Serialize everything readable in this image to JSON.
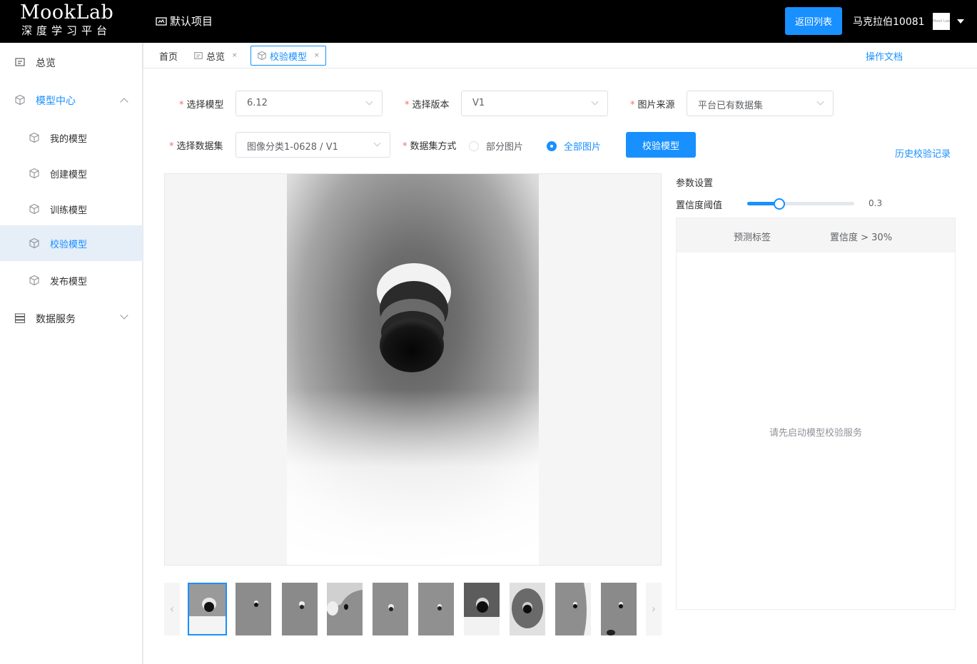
{
  "header": {
    "logo_main": "MookLab",
    "logo_sub": "深度学习平台",
    "project_name": "默认项目",
    "back_button": "返回列表",
    "username": "马克拉伯10081",
    "avatar_text": "Mook Lab"
  },
  "sidebar": {
    "items": [
      {
        "label": "总览",
        "icon": "overview-icon"
      },
      {
        "label": "模型中心",
        "icon": "cube-icon"
      },
      {
        "label": "我的模型",
        "icon": "cube-icon"
      },
      {
        "label": "创建模型",
        "icon": "cube-plus-icon"
      },
      {
        "label": "训练模型",
        "icon": "cube-icon"
      },
      {
        "label": "校验模型",
        "icon": "cube-check-icon"
      },
      {
        "label": "发布模型",
        "icon": "cube-icon"
      },
      {
        "label": "数据服务",
        "icon": "database-icon"
      }
    ]
  },
  "tabs": {
    "items": [
      {
        "label": "首页"
      },
      {
        "label": "总览",
        "close": "×"
      },
      {
        "label": "校验模型",
        "close": "×"
      }
    ],
    "docs": "操作文档"
  },
  "form": {
    "model_label": "选择模型",
    "model_value": "6.12",
    "version_label": "选择版本",
    "version_value": "V1",
    "source_label": "图片来源",
    "source_value": "平台已有数据集",
    "dataset_label": "选择数据集",
    "dataset_value": "图像分类1-0628 / V1",
    "mode_label": "数据集方式",
    "mode_option_partial": "部分图片",
    "mode_option_all": "全部图片",
    "verify_button": "校验模型",
    "history_link": "历史校验记录"
  },
  "params": {
    "title": "参数设置",
    "confidence_label": "置信度阈值",
    "confidence_value": "0.3",
    "confidence_fraction": 0.3
  },
  "results": {
    "col_label": "预测标签",
    "col_conf": "置信度 > 30%",
    "empty_text": "请先启动模型校验服务"
  },
  "thumbnails": {
    "count": 10,
    "selected_index": 0,
    "prev": "‹",
    "next": "›"
  },
  "colors": {
    "accent": "#1890ff",
    "required": "#f56c6c",
    "topbar": "#000000"
  }
}
